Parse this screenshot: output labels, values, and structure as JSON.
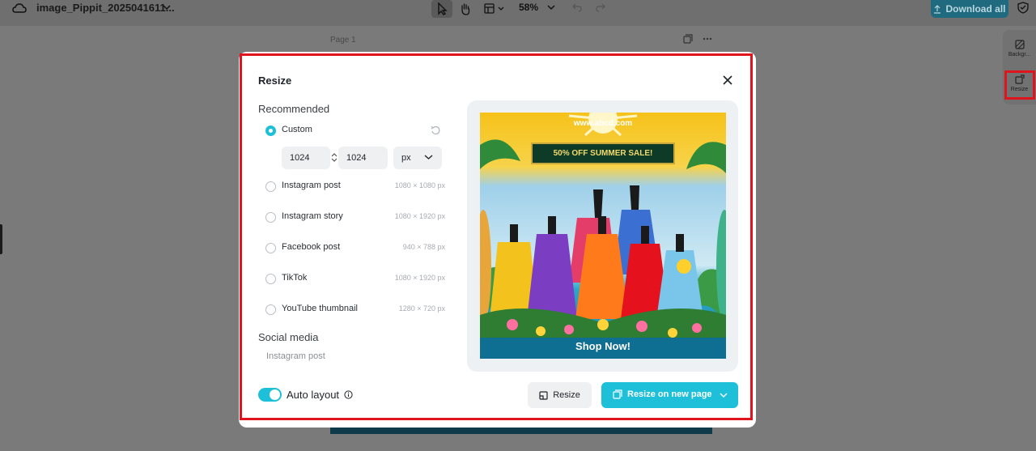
{
  "topbar": {
    "filename": "image_Pippit_2025041611...",
    "zoom": "58%",
    "download_label": "Download all"
  },
  "canvas": {
    "page_label": "Page 1"
  },
  "rail": {
    "background_label": "Backgr...",
    "resize_label": "Resize"
  },
  "modal": {
    "title": "Resize",
    "recommended_title": "Recommended",
    "custom_label": "Custom",
    "width_value": "1024",
    "height_value": "1024",
    "unit": "px",
    "options": [
      {
        "label": "Instagram post",
        "dims": "1080 × 1080 px"
      },
      {
        "label": "Instagram story",
        "dims": "1080 × 1920 px"
      },
      {
        "label": "Facebook post",
        "dims": "940 × 788 px"
      },
      {
        "label": "TikTok",
        "dims": "1080 × 1920 px"
      },
      {
        "label": "YouTube thumbnail",
        "dims": "1280 × 720 px"
      }
    ],
    "social_title": "Social media",
    "social_sub": "Instagram post",
    "auto_layout_label": "Auto layout",
    "auto_layout_on": true,
    "resize_button": "Resize",
    "resize_new_page_button": "Resize on new page"
  },
  "preview": {
    "url": "www.abcd.com",
    "banner": "50% OFF SUMMER SALE!",
    "cta": "Shop Now!"
  },
  "colors": {
    "accent": "#1dc0d8",
    "highlight": "#e0141c",
    "download": "#1f6a7f"
  }
}
